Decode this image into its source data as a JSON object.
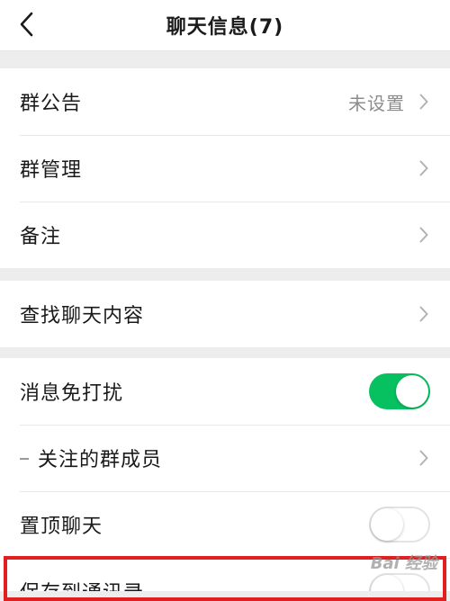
{
  "header": {
    "title": "聊天信息(7)"
  },
  "group1": {
    "announcement": {
      "label": "群公告",
      "value": "未设置"
    },
    "manage": {
      "label": "群管理"
    },
    "remark": {
      "label": "备注"
    }
  },
  "group2": {
    "search": {
      "label": "查找聊天内容"
    }
  },
  "group3": {
    "mute": {
      "label": "消息免打扰",
      "on": true
    },
    "followed": {
      "label": "关注的群成员"
    },
    "pin": {
      "label": "置顶聊天",
      "on": false
    },
    "save_contacts": {
      "label": "保存到通讯录",
      "on": false
    }
  },
  "colors": {
    "accent_green": "#07c160",
    "highlight_red": "#e02020"
  },
  "watermark": "Bai 经验",
  "icons": [
    "back-chevron-icon",
    "chevron-right-icon"
  ]
}
